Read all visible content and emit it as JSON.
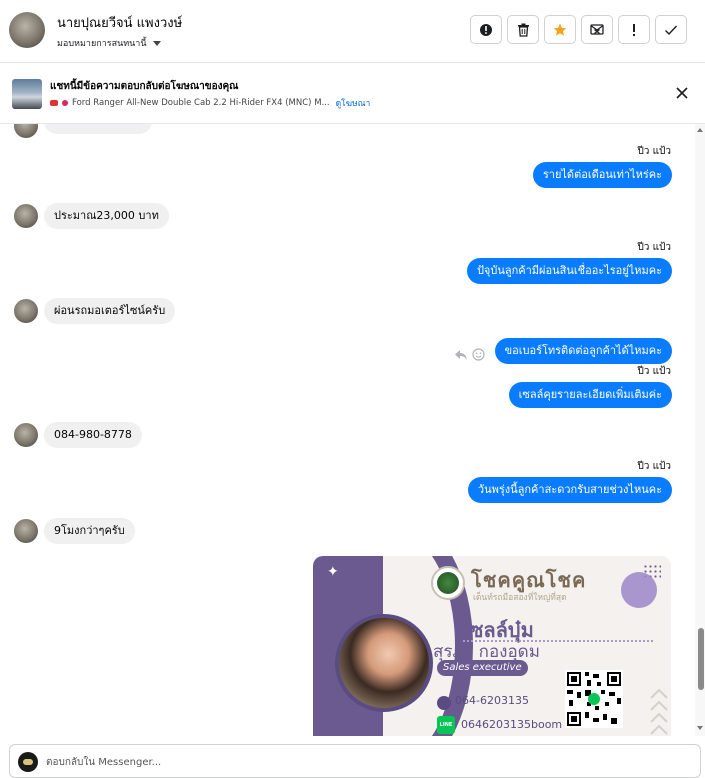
{
  "header": {
    "contact_name": "นายปุณยวีจน์ แพงวงษ์",
    "assign_label": "มอบหมายการสนทนานี้"
  },
  "icons": {
    "actions": [
      "alert-circle-icon",
      "trash-icon",
      "star-icon",
      "envelope-x-icon",
      "exclamation-icon",
      "check-icon"
    ],
    "close": "close-icon"
  },
  "colors": {
    "outgoing_bubble": "#0a7cff",
    "incoming_bubble": "#f0f0f0",
    "star_active": "#f4a11b",
    "link": "#0064d1",
    "card_purple": "#6b5a8f"
  },
  "ad_banner": {
    "title": "แชทนี้มีข้อความตอบกลับต่อโฆษณาของคุณ",
    "subtitle": "Ford Ranger All-New Double Cab 2.2 Hi-Rider FX4 (MNC) M...",
    "link": "ดูโฆษณา"
  },
  "messages": [
    {
      "direction": "out",
      "sender": "ปีว แป้ว",
      "text": "รายได้ต่อเดือนเท่าไหร่คะ"
    },
    {
      "direction": "in",
      "text": "ประมาณ23,000 บาท"
    },
    {
      "direction": "out",
      "sender": "ปีว แป้ว",
      "text": "ปัจุบันลูกค้ามีผ่อนสินเชื่ออะไรอยู่ไหมคะ"
    },
    {
      "direction": "in",
      "text": "ผ่อนรถมอเตอร์ไซน์ครับ"
    },
    {
      "direction": "out",
      "text": "ขอเบอร์โทรติดต่อลูกค้าได้ไหมคะ"
    },
    {
      "direction": "out",
      "sender": "ปีว แป้ว",
      "text": "เซลล์คุยรายละเอียดเพิ่มเติมค่ะ"
    },
    {
      "direction": "in",
      "text": "084-980-8778"
    },
    {
      "direction": "out",
      "sender": "ปีว แป้ว",
      "text": "วันพรุ่งนี้ลูกค้าสะดวกรับสายช่วงไหนคะ"
    },
    {
      "direction": "in",
      "text": "9โมงกว่าๆครับ"
    }
  ],
  "card": {
    "brand": "โชคคูณโชค",
    "slogan": "เต็นท์รถมือสองที่ใหญ่ที่สุด",
    "nickname": "เซลล์บุ๋ม",
    "fullname": "สุรภา   กองอุดม",
    "role": "Sales executive",
    "phone": "064-6203135",
    "line_badge": "LINE",
    "line_id": "0646203135boom"
  },
  "composer": {
    "placeholder": "ตอบกลับใน Messenger..."
  }
}
